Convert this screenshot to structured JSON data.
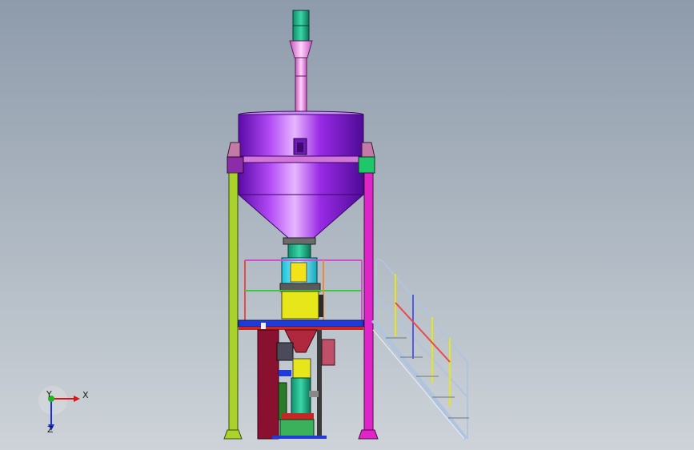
{
  "triad": {
    "x_label": "X",
    "y_label": "Y",
    "z_label": "Z"
  },
  "colors": {
    "background_top": "#8e9bab",
    "background_bottom": "#cdd3d8",
    "hopper": "#8b1fe0",
    "elevator_pipe": "#ee7ae6",
    "left_column": "#a9d22a",
    "right_column": "#e025c8",
    "platform": "#1f3ad8",
    "weigher": "#e6e61a",
    "stair_rail": "#b0c4de"
  }
}
